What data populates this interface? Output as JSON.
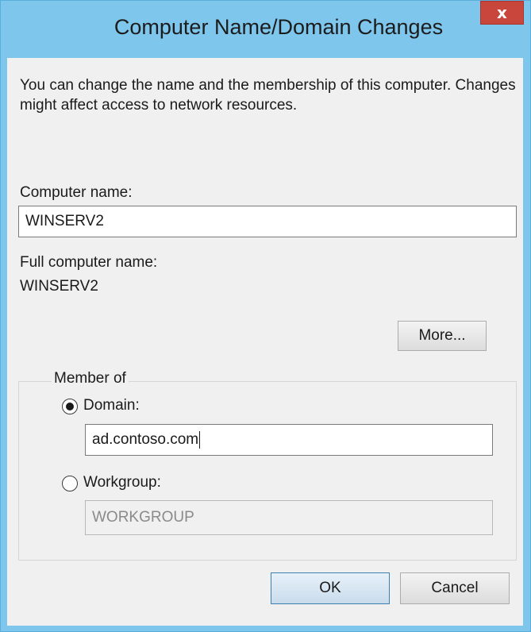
{
  "window": {
    "title": "Computer Name/Domain Changes",
    "close_glyph": "x"
  },
  "description": "You can change the name and the membership of this computer. Changes might affect access to network resources.",
  "computer_name": {
    "label": "Computer name:",
    "value": "WINSERV2"
  },
  "full_computer_name": {
    "label": "Full computer name:",
    "value": "WINSERV2"
  },
  "more_button": "More...",
  "member_of": {
    "legend": "Member of",
    "selected": "domain",
    "domain": {
      "label": "Domain:",
      "value": "ad.contoso.com"
    },
    "workgroup": {
      "label": "Workgroup:",
      "value": "WORKGROUP"
    }
  },
  "buttons": {
    "ok": "OK",
    "cancel": "Cancel"
  },
  "colors": {
    "title_bar": "#7ec6ec",
    "close_button": "#c9463d",
    "dialog_background": "#f0f0f0",
    "default_button_border": "#3c7fb1"
  },
  "icons": {
    "close": "close-icon",
    "radio_selected": "radio-selected-icon",
    "radio_unselected": "radio-unselected-icon"
  }
}
